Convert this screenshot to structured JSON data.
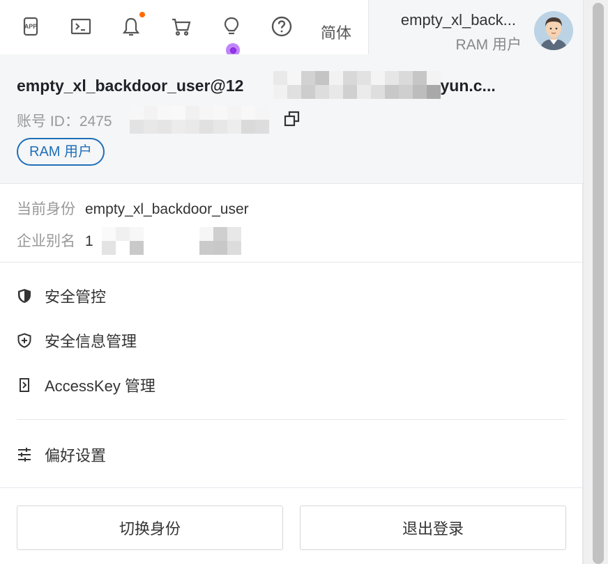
{
  "topbar": {
    "icons": [
      "app-icon",
      "terminal-icon",
      "bell-icon",
      "cart-icon",
      "lightbulb-icon",
      "help-icon"
    ],
    "notification_color": "#ff6a00",
    "language": "简体",
    "user_name": "empty_xl_back...",
    "user_role": "RAM 用户"
  },
  "account": {
    "email_prefix": "empty_xl_backdoor_user@12",
    "email_suffix": ".onaliyun.c...",
    "id_prefix": "账号 ID：2475",
    "id_suffix": "3",
    "badge": "RAM 用户",
    "badge_color": "#1e6fb8"
  },
  "identity": {
    "current_label": "当前身份",
    "current_value": "empty_xl_backdoor_user",
    "alias_label": "企业别名",
    "alias_value_prefix": "1"
  },
  "menu": {
    "items": [
      {
        "icon": "shield-filled-icon",
        "label": "安全管控"
      },
      {
        "icon": "shield-plus-icon",
        "label": "安全信息管理"
      },
      {
        "icon": "accesskey-icon",
        "label": "AccessKey 管理"
      },
      {
        "icon": "sliders-icon",
        "label": "偏好设置"
      }
    ]
  },
  "actions": {
    "switch_label": "切换身份",
    "logout_label": "退出登录"
  }
}
